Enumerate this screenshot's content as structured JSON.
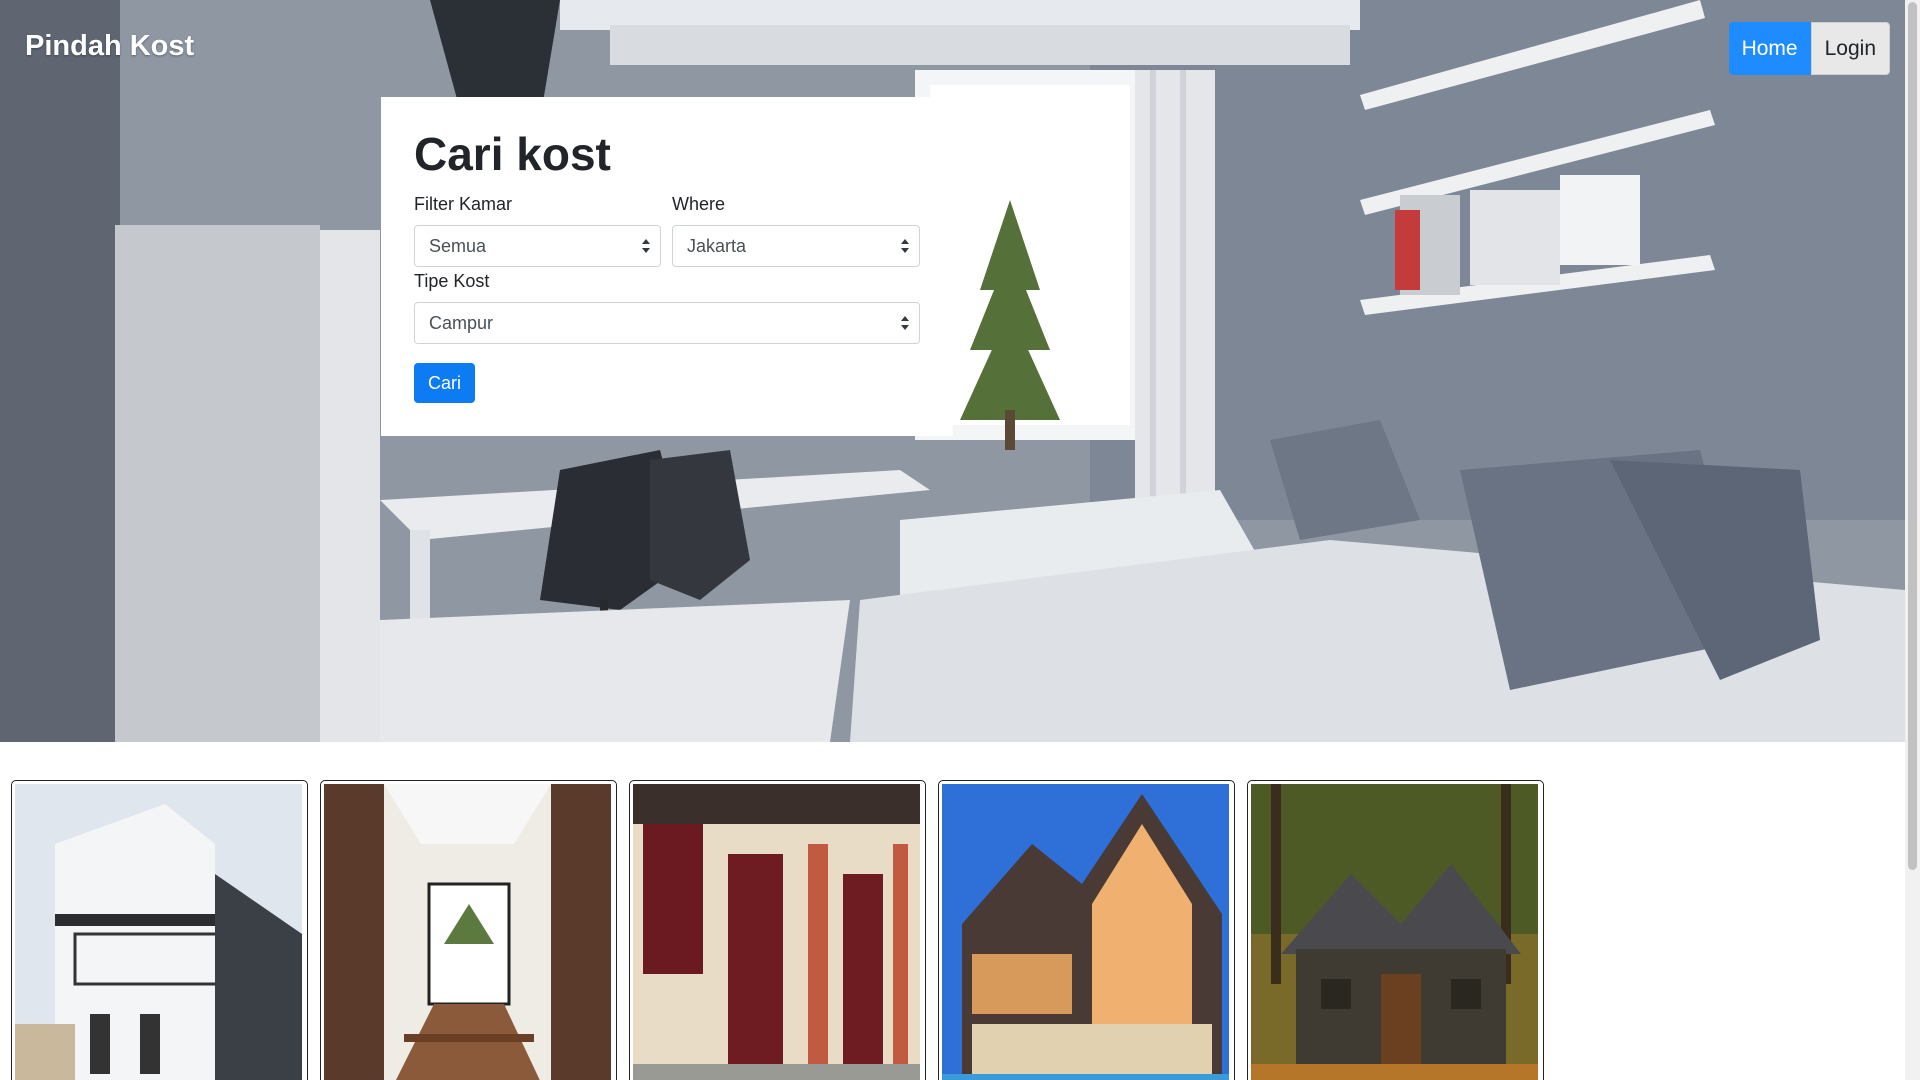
{
  "nav": {
    "brand": "Pindah Kost",
    "items": [
      {
        "label": "Home",
        "active": true
      },
      {
        "label": "Login",
        "active": false
      }
    ]
  },
  "search": {
    "title": "Cari kost",
    "filter_kamar": {
      "label": "Filter Kamar",
      "value": "Semua"
    },
    "where": {
      "label": "Where",
      "value": "Jakarta"
    },
    "tipe_kost": {
      "label": "Tipe Kost",
      "value": "Campur"
    },
    "submit_label": "Cari"
  },
  "listings": [
    {
      "image": "two-story-white-kost-building"
    },
    {
      "image": "interior-hallway-wooden-railing"
    },
    {
      "image": "corridor-with-red-doors"
    },
    {
      "image": "luxury-house-at-night"
    },
    {
      "image": "stone-cottage-in-autumn-forest"
    }
  ],
  "colors": {
    "accent": "#1e8cff",
    "button": "#0d7bf4"
  }
}
